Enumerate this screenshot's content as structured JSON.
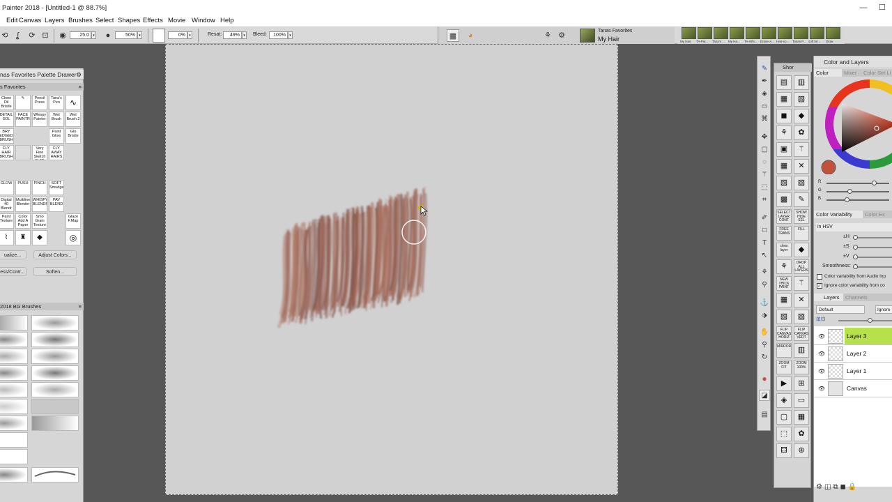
{
  "window": {
    "title": "Painter 2018 - [Untitled-1 @ 88.7%]",
    "minimize": "—",
    "maximize": "☐"
  },
  "menu": [
    "Edit",
    "Canvas",
    "Layers",
    "Brushes",
    "Select",
    "Shapes",
    "Effects",
    "Movie",
    "Window",
    "Help"
  ],
  "propbar": {
    "size": "25.0",
    "opacity": "50%",
    "grain": "0%",
    "resat_label": "Resat:",
    "resat": "49%",
    "bleed_label": "Bleed:",
    "bleed": "100%"
  },
  "brush_selector": {
    "library": "Tanas Favorites",
    "variant": "My Hair"
  },
  "recent_brushes": [
    "My Hair",
    "TA-Pai...",
    "Tana's ...",
    "My Ha...",
    "TA-Whi...",
    "Erase-A...",
    "Hair-so...",
    "Tanas P...",
    "soft bri...",
    "Glow"
  ],
  "left_panel": {
    "title": "nas Favorites Palette Drawer",
    "tab": "s Favorites",
    "brushes_row1": [
      "Clone Oil Bristle",
      "",
      "Pencil Press",
      "Tana's Pen",
      ""
    ],
    "brushes_row2": [
      "DETAIL SOL",
      "FACE PAINTR",
      "Whispy Painter",
      "Wet Brush",
      "Wet Brush 2"
    ],
    "brushes_row3": [
      "BRY EDGED BRUSH",
      "",
      "FLY AWAY HAIR",
      "Paint Glow",
      "Glo Bristle"
    ],
    "brushes_row4": [
      "FLY HAIR BRUSH",
      "",
      "Very Fine Sketch FLAT",
      "FLY AWAY HAIRS",
      ""
    ],
    "brushes_row5": [
      "GLOW",
      "PUSH",
      "PINCH",
      "SOFT Smudge",
      ""
    ],
    "brushes_row6": [
      "Digital 40 Blendr",
      "Multiline Blender",
      "WHISPY BLENDR",
      "PAV BLEND",
      ""
    ],
    "brushes_row7": [
      "Paint Texture",
      "Color Add A Paper",
      "Smo Grain Texture",
      "",
      "Glaze F.Map"
    ],
    "actions": [
      "ualize...",
      "Adjust Colors...",
      "ess/Contr...",
      "Soften..."
    ],
    "bg_title": "2018 BG Brushes"
  },
  "shortcuts": [
    "",
    "",
    "",
    "",
    "",
    "",
    "",
    "",
    "",
    "",
    "",
    "",
    "",
    "",
    "",
    "",
    "SELECT LAYER CONT",
    "SHOW HIDE SEL",
    "FREE TRANS",
    "FILL",
    "clear layer",
    "",
    "",
    "DROP ALL LAYERS",
    "NEW THICK PAINT",
    "",
    "",
    "",
    "",
    "",
    "FLIP CANVAS HORIZ",
    "FLIP CANVAS VERT",
    "MIRROR",
    "",
    "ZOOM FIT",
    "ZOOM 100%"
  ],
  "right": {
    "title": "Color and Layers",
    "color_tabs": [
      "Color",
      "Mixer",
      "Color Set Li"
    ],
    "rgb_labels": [
      "R",
      "G",
      "B"
    ],
    "rgb": [
      0.75,
      0.35,
      0.3
    ],
    "current_color": "#c2503a",
    "variability_tabs": [
      "Color Variability",
      "Color Ex"
    ],
    "variability_mode": "in HSV",
    "var_labels": [
      "±H",
      "±S",
      "±V",
      "Smoothness:"
    ],
    "var_checks": [
      "Color variability from Audio Inp",
      "Ignore color variability from co"
    ],
    "layer_tabs": [
      "Layers",
      "Channels"
    ],
    "composite": "Default",
    "ignore": "Ignore",
    "layers": [
      "Layer 3",
      "Layer 2",
      "Layer 1",
      "Canvas"
    ],
    "selected_layer": "#b6e14b"
  }
}
